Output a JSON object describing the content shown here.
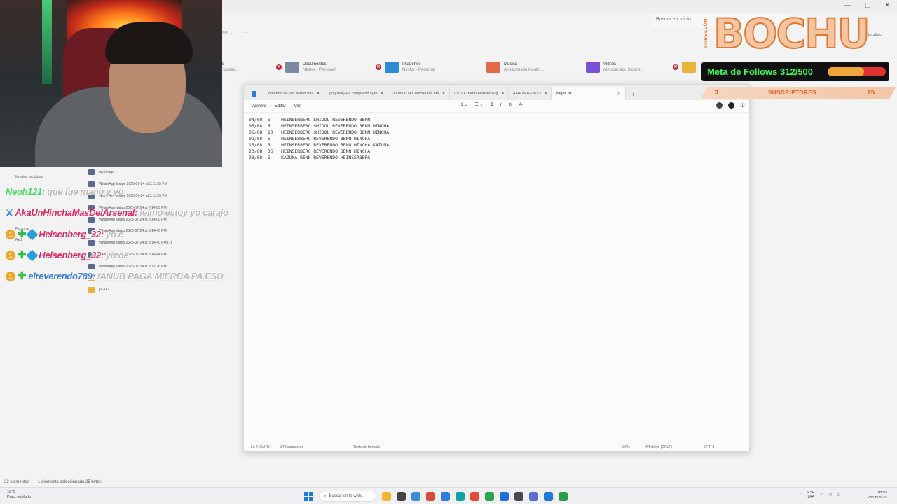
{
  "explorer": {
    "search_placeholder": "Buscar en Inicio",
    "toolbar": {
      "filter": "iltro ⌄",
      "more": "···"
    },
    "details_label": "Detalles",
    "window_controls": [
      "—",
      "▢",
      "✕"
    ],
    "quick_access": [
      {
        "title": "ags",
        "sub": "do localm..."
      },
      {
        "title": "Documentos",
        "sub": "Nestor - Personal",
        "color": "#7a8aa3"
      },
      {
        "title": "Imágenes",
        "sub": "Nestor - Personal",
        "color": "#2f8bd6"
      },
      {
        "title": "Música",
        "sub": "Almacenado localm...",
        "color": "#e06a4a"
      },
      {
        "title": "Videos",
        "sub": "Almacenado localm...",
        "color": "#7a4fd6"
      }
    ],
    "nav": [
      "fémulos recibidos",
      "Personal",
      "Red"
    ],
    "files": [
      {
        "name": "my-image",
        "type": "img"
      },
      {
        "name": "WhatsApp Image 2025-07-24 at 3.13.55 PM",
        "type": "img"
      },
      {
        "name": "WhatsApp Image 2025-07-24 at 3.13.55 PM",
        "type": "img"
      },
      {
        "name": "WhatsApp Video 2025-07-24 at 3.14.00 PM",
        "type": "img"
      },
      {
        "name": "WhatsApp Video 2025-07-24 at 3.14.00 PM",
        "type": "img"
      },
      {
        "name": "WhatsApp Video 2025-07-24 at 3.14.40 PM",
        "type": "img"
      },
      {
        "name": "WhatsApp Video 2025-07-24 at 3.14.40 PM (1)",
        "type": "img"
      },
      {
        "name": "WhatsApp Video 2025-07-24 at 3.14.44 PM",
        "type": "img"
      },
      {
        "name": "WhatsApp Video 2025-07-24 at 3.17.26 PM",
        "type": "img"
      },
      {
        "name": "",
        "type": "folder"
      },
      {
        "name": "jrs-141",
        "type": "folder"
      }
    ],
    "status": {
      "count": "23 elementos",
      "selected": "1 elemento seleccionado 25 bytes"
    }
  },
  "notepad": {
    "tabs": [
      {
        "label": "Comando de voz activo !ras"
      },
      {
        "label": "@${user} Ha comprado ${ite"
      },
      {
        "label": "23 0806 aka hincha del ars"
      },
      {
        "label": "0307 4. benn heinserberg"
      },
      {
        "label": "4 REVERENDO"
      },
      {
        "label": "pagos.txt",
        "active": true
      }
    ],
    "new_tab": "+",
    "menu": [
      "Archivo",
      "Editar",
      "Ver"
    ],
    "format": {
      "heading": "H1 ⌄",
      "list": "☰ ⌄",
      "bold": "B",
      "italic": "I",
      "link": "⊘",
      "clear": "A̶"
    },
    "lines": [
      "04/08  5    HEINSERBERG SHIDOU REVERENDO BENN",
      "05/08  5    HEINSERBERG SHIDOU REVERENDO BENN HINCHA",
      "06/08  10   HEINSERBERG SHIDOU REVERENDO BENN HINCHA",
      "09/08  5    HEINSERBERG REVERENDO BENN HINCHA",
      "15/08  5    HEINSERBERG REVERENDO BENN HINCHA KAZUMA",
      "20/08  35   HEINSERBERG REVERENDO BENN HINCHA",
      "23/08  5    KAZUMA BENN REVERENDO HEINSERBERG"
    ],
    "status": {
      "position": "Ln 7, Col 46",
      "chars": "344 caracteres",
      "format": "Texto sin formato",
      "zoom": "100%",
      "line_ending": "Windows (CRLF)",
      "encoding": "UTF-8"
    }
  },
  "chat": [
    {
      "user": "Neoh121:",
      "text": "que fue mano y yo",
      "user_color": "#4cd964",
      "badges": []
    },
    {
      "user": "AkaUnHinchaMasDelArsenal:",
      "text": "!elmo estoy yo carajo",
      "user_color": "#e0245e",
      "badges": [
        "sword"
      ]
    },
    {
      "user": "Heisenberg_32:",
      "text": "yo e",
      "user_color": "#e0245e",
      "badges": [
        "num",
        "plus",
        "gem"
      ]
    },
    {
      "user": "Heisenberg_32:",
      "text": "yo oe",
      "user_color": "#e0245e",
      "badges": [
        "num",
        "plus",
        "gem"
      ]
    },
    {
      "user": "elreverendo789:",
      "text": "!ANUB PAGA MIERDA PA ESO",
      "user_color": "#3a7be0",
      "badges": [
        "num",
        "plus"
      ]
    }
  ],
  "badge_number": "1",
  "logo": {
    "text": "BOCHU",
    "vertical": "PABELLÓN"
  },
  "follow_goal": {
    "label": "Meta de Follows 312/500",
    "current": 312,
    "target": 500
  },
  "subs": {
    "left": "3",
    "label": "SUSCRIPTORES",
    "right": "25"
  },
  "taskbar": {
    "weather_temp": "18°C",
    "weather_desc": "Parc. nublado",
    "search_placeholder": "Buscar en la web...",
    "lang_top": "ESP",
    "lang_bottom": "LAA",
    "time": "18:50",
    "date": "23/08/2025",
    "apps": [
      "#f2b632",
      "#444",
      "#3b8fd6",
      "#d94a3a",
      "#2c7be0",
      "#0fa3a3",
      "#e04a3a",
      "#2aa84a",
      "#1c6fd6",
      "#4a4a4a",
      "#5b6bd6",
      "#1f7ae0",
      "#2a9d4a"
    ]
  }
}
